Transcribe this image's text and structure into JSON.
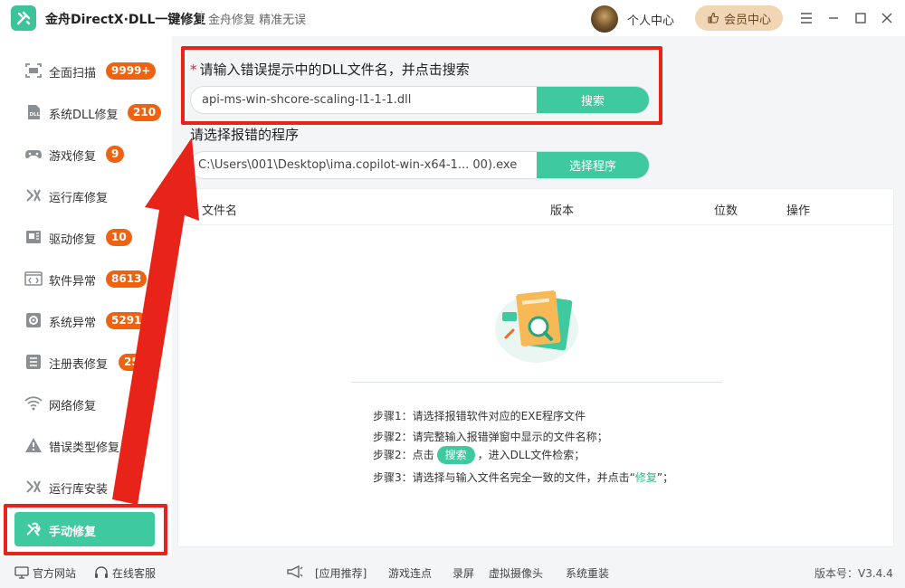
{
  "titlebar": {
    "app_title": "金舟DirectX·DLL一键修复",
    "app_subtitle": "金舟修复 精准无误",
    "user_center": "个人中心",
    "vip_label": "会员中心"
  },
  "sidebar": {
    "items": [
      {
        "label": "全面扫描",
        "badge": "9999+",
        "icon": "scan-icon"
      },
      {
        "label": "系统DLL修复",
        "badge": "210",
        "icon": "dll-icon"
      },
      {
        "label": "游戏修复",
        "badge": "9",
        "icon": "gamepad-icon"
      },
      {
        "label": "运行库修复",
        "badge": "",
        "icon": "runtime-icon"
      },
      {
        "label": "驱动修复",
        "badge": "10",
        "icon": "driver-icon"
      },
      {
        "label": "软件异常",
        "badge": "8613",
        "icon": "code-icon"
      },
      {
        "label": "系统异常",
        "badge": "5291",
        "icon": "gear-icon"
      },
      {
        "label": "注册表修复",
        "badge": "25",
        "icon": "registry-icon"
      },
      {
        "label": "网络修复",
        "badge": "",
        "icon": "wifi-icon"
      },
      {
        "label": "错误类型修复",
        "badge": "",
        "icon": "warning-icon"
      },
      {
        "label": "运行库安装",
        "badge": "",
        "icon": "install-icon"
      }
    ],
    "active_item": {
      "label": "手动修复",
      "icon": "wrench-icon"
    }
  },
  "main": {
    "search_prompt": "请输入错误提示中的DLL文件名，并点击搜索",
    "search_value": "api-ms-win-shcore-scaling-l1-1-1.dll",
    "search_button": "搜索",
    "program_prompt": "请选择报错的程序",
    "program_value": "C:\\Users\\001\\Desktop\\ima.copilot-win-x64-1... 00).exe",
    "program_button": "选择程序"
  },
  "table": {
    "headers": [
      "文件名",
      "版本",
      "位数",
      "操作"
    ],
    "rows": []
  },
  "steps": {
    "step1": "步骤1：请选择报错软件对应的EXE程序文件",
    "step2": "步骤2：请完整输入报错弹窗中显示的文件名称；",
    "step3_prefix": "步骤2：点击",
    "step3_pill": "搜索",
    "step3_suffix": "，进入DLL文件检索；",
    "step4_prefix": "步骤3：请选择与输入文件名完全一致的文件，并点击“",
    "step4_green": "修复",
    "step4_suffix": "”；"
  },
  "footer": {
    "official_site": "官方网站",
    "online_service": "在线客服",
    "app_recommend": "[应用推荐]",
    "links": [
      "游戏连点",
      "录屏",
      "虚拟摄像头",
      "系统重装"
    ],
    "version": "版本号：V3.4.4"
  },
  "colors": {
    "accent": "#3ec99f",
    "badge": "#f0620f",
    "highlight_red": "#e8231a",
    "vip_bg": "#f0d6b4"
  }
}
